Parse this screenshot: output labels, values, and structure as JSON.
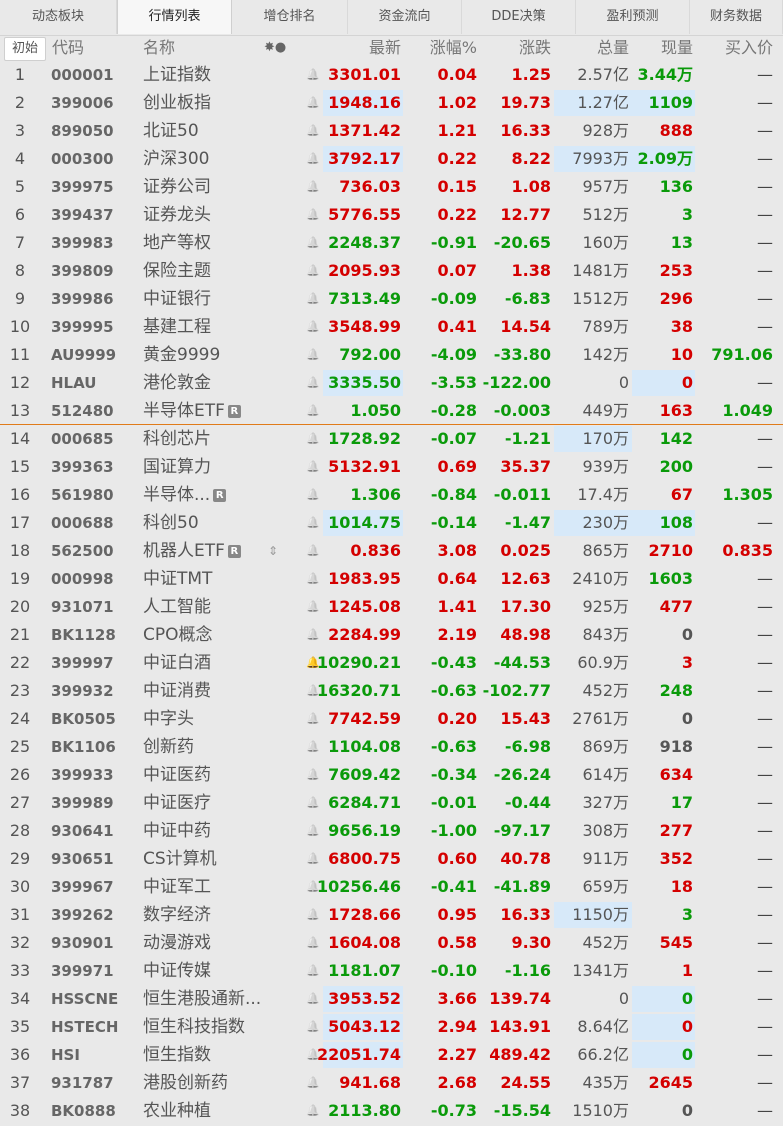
{
  "tabs": [
    "动态板块",
    "行情列表",
    "增仓排名",
    "资金流向",
    "DDE决策",
    "盈利预测",
    "财务数据"
  ],
  "active_tab": 1,
  "header": {
    "init": "初始",
    "code": "代码",
    "name": "名称",
    "icons": "✸●",
    "last": "最新",
    "pct": "涨幅%",
    "chg": "涨跌",
    "vol": "总量",
    "now": "现量",
    "bid": "买入价"
  },
  "colors": {
    "up": "#d40000",
    "down": "#0a9a0a",
    "highlight": "#d7e9f9",
    "separator": "#e07b1a"
  },
  "rows": [
    {
      "idx": "1",
      "code": "000001",
      "name": "上证指数",
      "last": "3301.01",
      "pct": "0.04",
      "chg": "1.25",
      "vol": "2.57亿",
      "now": "3.44万",
      "bid": "—",
      "d": "up",
      "nd": "down"
    },
    {
      "idx": "2",
      "code": "399006",
      "name": "创业板指",
      "last": "1948.16",
      "pct": "1.02",
      "chg": "19.73",
      "vol": "1.27亿",
      "now": "1109",
      "bid": "—",
      "d": "up",
      "nd": "down",
      "hl_last": true,
      "hl_vol": true,
      "hl_now": true
    },
    {
      "idx": "3",
      "code": "899050",
      "name": "北证50",
      "last": "1371.42",
      "pct": "1.21",
      "chg": "16.33",
      "vol": "928万",
      "now": "888",
      "bid": "—",
      "d": "up",
      "nd": "up"
    },
    {
      "idx": "4",
      "code": "000300",
      "name": "沪深300",
      "last": "3792.17",
      "pct": "0.22",
      "chg": "8.22",
      "vol": "7993万",
      "now": "2.09万",
      "bid": "—",
      "d": "up",
      "nd": "down",
      "hl_last": true,
      "hl_vol": true,
      "hl_now": true
    },
    {
      "idx": "5",
      "code": "399975",
      "name": "证券公司",
      "last": "736.03",
      "pct": "0.15",
      "chg": "1.08",
      "vol": "957万",
      "now": "136",
      "bid": "—",
      "d": "up",
      "nd": "down"
    },
    {
      "idx": "6",
      "code": "399437",
      "name": "证券龙头",
      "last": "5776.55",
      "pct": "0.22",
      "chg": "12.77",
      "vol": "512万",
      "now": "3",
      "bid": "—",
      "d": "up",
      "nd": "down"
    },
    {
      "idx": "7",
      "code": "399983",
      "name": "地产等权",
      "last": "2248.37",
      "pct": "-0.91",
      "chg": "-20.65",
      "vol": "160万",
      "now": "13",
      "bid": "—",
      "d": "down",
      "nd": "down"
    },
    {
      "idx": "8",
      "code": "399809",
      "name": "保险主题",
      "last": "2095.93",
      "pct": "0.07",
      "chg": "1.38",
      "vol": "1481万",
      "now": "253",
      "bid": "—",
      "d": "up",
      "nd": "up"
    },
    {
      "idx": "9",
      "code": "399986",
      "name": "中证银行",
      "last": "7313.49",
      "pct": "-0.09",
      "chg": "-6.83",
      "vol": "1512万",
      "now": "296",
      "bid": "—",
      "d": "down",
      "nd": "up"
    },
    {
      "idx": "10",
      "code": "399995",
      "name": "基建工程",
      "last": "3548.99",
      "pct": "0.41",
      "chg": "14.54",
      "vol": "789万",
      "now": "38",
      "bid": "—",
      "d": "up",
      "nd": "up"
    },
    {
      "idx": "11",
      "code": "AU9999",
      "name": "黄金9999",
      "last": "792.00",
      "pct": "-4.09",
      "chg": "-33.80",
      "vol": "142万",
      "now": "10",
      "bid": "791.06",
      "d": "down",
      "nd": "up",
      "bd": "down"
    },
    {
      "idx": "12",
      "code": "HLAU",
      "name": "港伦敦金",
      "last": "3335.50",
      "pct": "-3.53",
      "chg": "-122.00",
      "vol": "0",
      "now": "0",
      "bid": "—",
      "d": "down",
      "nd": "up",
      "hl_last": true,
      "hl_now": true
    },
    {
      "idx": "13",
      "code": "512480",
      "name": "半导体ETF",
      "badge": "R",
      "last": "1.050",
      "pct": "-0.28",
      "chg": "-0.003",
      "vol": "449万",
      "now": "163",
      "bid": "1.049",
      "d": "down",
      "nd": "up",
      "bd": "down"
    },
    {
      "idx": "14",
      "code": "000685",
      "name": "科创芯片",
      "last": "1728.92",
      "pct": "-0.07",
      "chg": "-1.21",
      "vol": "170万",
      "now": "142",
      "bid": "—",
      "d": "down",
      "nd": "down",
      "hl_vol": true
    },
    {
      "idx": "15",
      "code": "399363",
      "name": "国证算力",
      "last": "5132.91",
      "pct": "0.69",
      "chg": "35.37",
      "vol": "939万",
      "now": "200",
      "bid": "—",
      "d": "up",
      "nd": "down"
    },
    {
      "idx": "16",
      "code": "561980",
      "name": "半导体...",
      "badge": "R",
      "last": "1.306",
      "pct": "-0.84",
      "chg": "-0.011",
      "vol": "17.4万",
      "now": "67",
      "bid": "1.305",
      "d": "down",
      "nd": "up",
      "bd": "down"
    },
    {
      "idx": "17",
      "code": "000688",
      "name": "科创50",
      "last": "1014.75",
      "pct": "-0.14",
      "chg": "-1.47",
      "vol": "230万",
      "now": "108",
      "bid": "—",
      "d": "down",
      "nd": "down",
      "hl_last": true,
      "hl_vol": true,
      "hl_now": true
    },
    {
      "idx": "18",
      "code": "562500",
      "name": "机器人ETF",
      "badge": "R",
      "alarm": "⇕",
      "last": "0.836",
      "pct": "3.08",
      "chg": "0.025",
      "vol": "865万",
      "now": "2710",
      "bid": "0.835",
      "d": "up",
      "nd": "up",
      "bd": "up"
    },
    {
      "idx": "19",
      "code": "000998",
      "name": "中证TMT",
      "last": "1983.95",
      "pct": "0.64",
      "chg": "12.63",
      "vol": "2410万",
      "now": "1603",
      "bid": "—",
      "d": "up",
      "nd": "down"
    },
    {
      "idx": "20",
      "code": "931071",
      "name": "人工智能",
      "last": "1245.08",
      "pct": "1.41",
      "chg": "17.30",
      "vol": "925万",
      "now": "477",
      "bid": "—",
      "d": "up",
      "nd": "up"
    },
    {
      "idx": "21",
      "code": "BK1128",
      "name": "CPO概念",
      "last": "2284.99",
      "pct": "2.19",
      "chg": "48.98",
      "vol": "843万",
      "now": "0",
      "bid": "—",
      "d": "up",
      "nd": "flat"
    },
    {
      "idx": "22",
      "code": "399997",
      "name": "中证白酒",
      "alarm_on": true,
      "last": "10290.21",
      "pct": "-0.43",
      "chg": "-44.53",
      "vol": "60.9万",
      "now": "3",
      "bid": "—",
      "d": "down",
      "nd": "up"
    },
    {
      "idx": "23",
      "code": "399932",
      "name": "中证消费",
      "last": "16320.71",
      "pct": "-0.63",
      "chg": "-102.77",
      "vol": "452万",
      "now": "248",
      "bid": "—",
      "d": "down",
      "nd": "down"
    },
    {
      "idx": "24",
      "code": "BK0505",
      "name": "中字头",
      "last": "7742.59",
      "pct": "0.20",
      "chg": "15.43",
      "vol": "2761万",
      "now": "0",
      "bid": "—",
      "d": "up",
      "nd": "flat"
    },
    {
      "idx": "25",
      "code": "BK1106",
      "name": "创新药",
      "last": "1104.08",
      "pct": "-0.63",
      "chg": "-6.98",
      "vol": "869万",
      "now": "918",
      "bid": "—",
      "d": "down",
      "nd": "flat"
    },
    {
      "idx": "26",
      "code": "399933",
      "name": "中证医药",
      "last": "7609.42",
      "pct": "-0.34",
      "chg": "-26.24",
      "vol": "614万",
      "now": "634",
      "bid": "—",
      "d": "down",
      "nd": "up"
    },
    {
      "idx": "27",
      "code": "399989",
      "name": "中证医疗",
      "last": "6284.71",
      "pct": "-0.01",
      "chg": "-0.44",
      "vol": "327万",
      "now": "17",
      "bid": "—",
      "d": "down",
      "nd": "down"
    },
    {
      "idx": "28",
      "code": "930641",
      "name": "中证中药",
      "last": "9656.19",
      "pct": "-1.00",
      "chg": "-97.17",
      "vol": "308万",
      "now": "277",
      "bid": "—",
      "d": "down",
      "nd": "up"
    },
    {
      "idx": "29",
      "code": "930651",
      "name": "CS计算机",
      "last": "6800.75",
      "pct": "0.60",
      "chg": "40.78",
      "vol": "911万",
      "now": "352",
      "bid": "—",
      "d": "up",
      "nd": "up"
    },
    {
      "idx": "30",
      "code": "399967",
      "name": "中证军工",
      "last": "10256.46",
      "pct": "-0.41",
      "chg": "-41.89",
      "vol": "659万",
      "now": "18",
      "bid": "—",
      "d": "down",
      "nd": "up"
    },
    {
      "idx": "31",
      "code": "399262",
      "name": "数字经济",
      "last": "1728.66",
      "pct": "0.95",
      "chg": "16.33",
      "vol": "1150万",
      "now": "3",
      "bid": "—",
      "d": "up",
      "nd": "down",
      "hl_vol": true
    },
    {
      "idx": "32",
      "code": "930901",
      "name": "动漫游戏",
      "last": "1604.08",
      "pct": "0.58",
      "chg": "9.30",
      "vol": "452万",
      "now": "545",
      "bid": "—",
      "d": "up",
      "nd": "up"
    },
    {
      "idx": "33",
      "code": "399971",
      "name": "中证传媒",
      "last": "1181.07",
      "pct": "-0.10",
      "chg": "-1.16",
      "vol": "1341万",
      "now": "1",
      "bid": "—",
      "d": "down",
      "nd": "up"
    },
    {
      "idx": "34",
      "code": "HSSCNE",
      "name": "恒生港股通新...",
      "last": "3953.52",
      "pct": "3.66",
      "chg": "139.74",
      "vol": "0",
      "now": "0",
      "bid": "—",
      "d": "up",
      "nd": "down",
      "hl_last": true,
      "hl_now": true
    },
    {
      "idx": "35",
      "code": "HSTECH",
      "name": "恒生科技指数",
      "last": "5043.12",
      "pct": "2.94",
      "chg": "143.91",
      "vol": "8.64亿",
      "now": "0",
      "bid": "—",
      "d": "up",
      "nd": "up",
      "hl_last": true,
      "hl_now": true
    },
    {
      "idx": "36",
      "code": "HSI",
      "name": "恒生指数",
      "last": "22051.74",
      "pct": "2.27",
      "chg": "489.42",
      "vol": "66.2亿",
      "now": "0",
      "bid": "—",
      "d": "up",
      "nd": "down",
      "hl_last": true,
      "hl_now": true
    },
    {
      "idx": "37",
      "code": "931787",
      "name": "港股创新药",
      "last": "941.68",
      "pct": "2.68",
      "chg": "24.55",
      "vol": "435万",
      "now": "2645",
      "bid": "—",
      "d": "up",
      "nd": "up"
    },
    {
      "idx": "38",
      "code": "BK0888",
      "name": "农业种植",
      "last": "2113.80",
      "pct": "-0.73",
      "chg": "-15.54",
      "vol": "1510万",
      "now": "0",
      "bid": "—",
      "d": "down",
      "nd": "flat"
    }
  ]
}
